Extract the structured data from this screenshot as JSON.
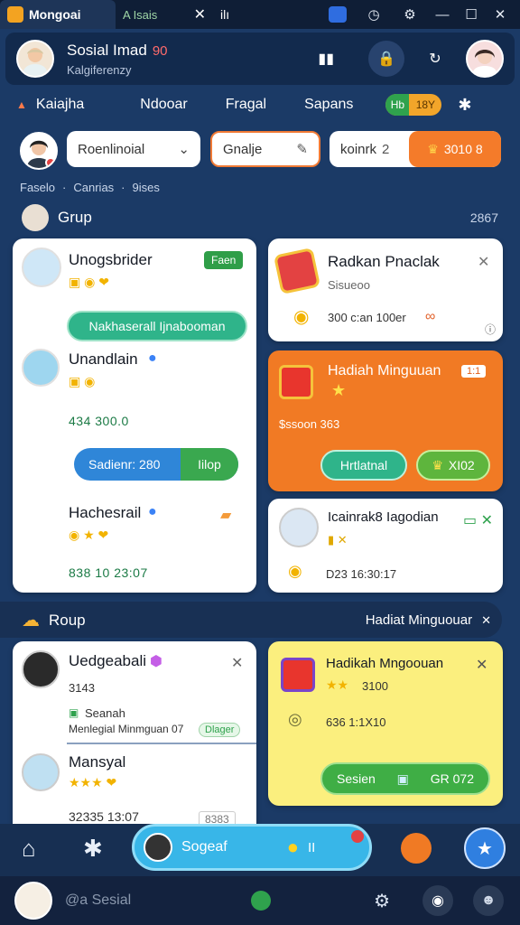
{
  "titlebar": {
    "tab1_label": "Mongoai",
    "tab2_label": "A Isais",
    "tab3_label": "ilı"
  },
  "header": {
    "name": "Sosial Imad",
    "name_badge": "90",
    "subtitle": "Kalgiferenzy"
  },
  "nav": {
    "items": [
      "Kaiajha",
      "Ndooar",
      "Fragal",
      "Sapans"
    ],
    "badge_left": "Hb",
    "badge_right": "18Y"
  },
  "filters": {
    "select_value": "Roenlinoial",
    "field_value": "Gnalje",
    "search_value": "koinrk",
    "search_count": "2",
    "coins": "3010 8"
  },
  "tags": [
    "Faselo",
    "Canrias",
    "9ises"
  ],
  "section1": {
    "title": "Grup",
    "count": "2867"
  },
  "section2": {
    "title": "Roup",
    "right_label": "Hadiat Minguouar"
  },
  "left_card1": {
    "title1": "Unogsbrider",
    "badge": "Faen",
    "button1": "Nakhaserall Ijnabooman",
    "title2": "Unandlain",
    "amount2": "434 300.0",
    "button2": "Sadienr: 280",
    "button2_right": "Iilop",
    "title3": "Hachesrail",
    "amount3": "838 10 23:07"
  },
  "right_card1": {
    "title": "Radkan Pnaclak",
    "sub": "Sisueoo",
    "amount": "300 c:an 100er"
  },
  "orange_card": {
    "title": "Hadiah Minguuan",
    "badge": "1:1",
    "amount": "$ssoon 363",
    "button1": "Hrtlatnal",
    "button2": "XI02"
  },
  "right_card3": {
    "title": "Icainrak8 Iagodian",
    "amount": "D23 16:30:17"
  },
  "left_card2": {
    "title1": "Uedgeabali",
    "amount1": "3143",
    "note": "Seanah",
    "note2": "Menlegial Minmguan 07",
    "note_badge": "Dlager",
    "title2": "Mansyal",
    "amount2": "32335 13:07",
    "amount2_right": "8383"
  },
  "yellow_card": {
    "title": "Hadikah Mngoouan",
    "sub": "3100",
    "amount": "636 1:1X10",
    "button_label": "Sesien",
    "button_right": "GR 072"
  },
  "bottombar": {
    "center_label": "Sogeaf",
    "center_badge": "II"
  },
  "bottom2": {
    "search_placeholder": "@a Sesial"
  }
}
